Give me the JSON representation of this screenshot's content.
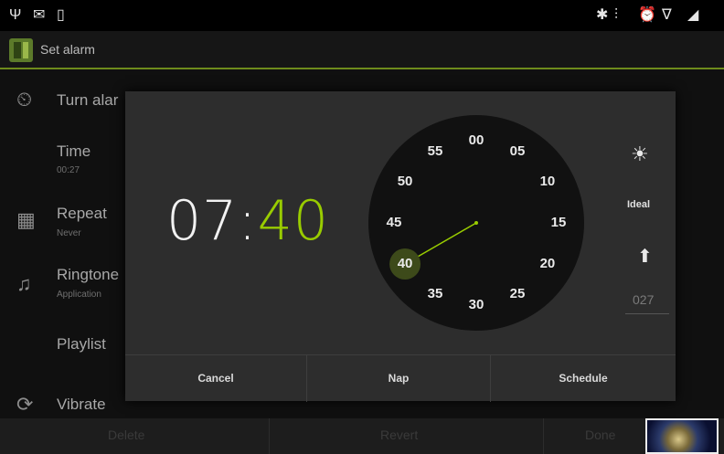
{
  "status_bar": {
    "left_icons": [
      "usb-icon",
      "email-icon",
      "battery-outline-icon"
    ],
    "right_icons": [
      "bluetooth-icon",
      "vibrate-icon",
      "alarm-icon",
      "wifi-icon",
      "signal-icon"
    ]
  },
  "action_bar": {
    "title": "Set alarm"
  },
  "settings_list": [
    {
      "title": "Turn alar",
      "subtitle": "",
      "icon": "alarm-clock-icon"
    },
    {
      "title": "Time",
      "subtitle": "00:27",
      "icon": ""
    },
    {
      "title": "Repeat",
      "subtitle": "Never",
      "icon": "calendar-icon"
    },
    {
      "title": "Ringtone",
      "subtitle": "Application",
      "icon": "music-note-icon"
    },
    {
      "title": "Playlist",
      "subtitle": "",
      "icon": ""
    },
    {
      "title": "Vibrate",
      "subtitle": "",
      "icon": "vibrate-icon"
    }
  ],
  "bottom_bar": {
    "buttons": [
      "Delete",
      "Revert",
      "Done"
    ]
  },
  "dialog": {
    "time": {
      "hours": "07",
      "separator": ":",
      "minutes": "40"
    },
    "clock": {
      "numbers": [
        "00",
        "05",
        "10",
        "15",
        "20",
        "25",
        "30",
        "35",
        "40",
        "45",
        "50",
        "55"
      ],
      "selected_minute": 40,
      "selected_label": "40"
    },
    "side": {
      "weather_icon": "sunrise-icon",
      "mode_label": "Ideal",
      "mic_icon": "microphone-icon",
      "value": "027"
    },
    "actions": {
      "cancel": "Cancel",
      "nap": "Nap",
      "schedule": "Schedule"
    }
  },
  "colors": {
    "accent": "#99cc00",
    "dialog_bg": "#2d2d2d",
    "clock_bg": "#111111"
  }
}
